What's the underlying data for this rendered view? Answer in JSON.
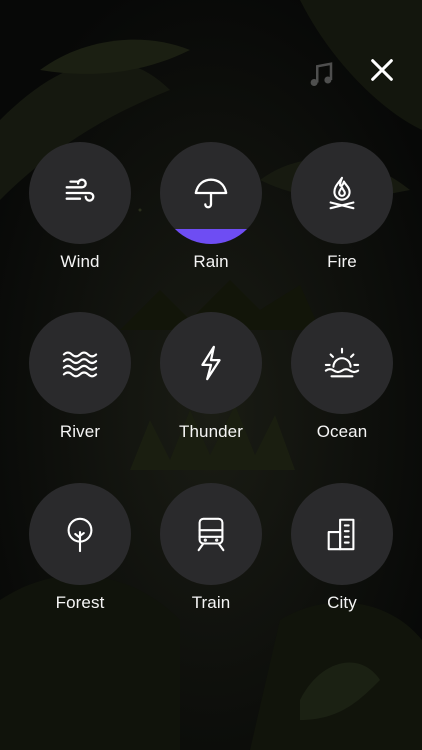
{
  "top_bar": {
    "music_icon": "music-note-icon",
    "close_icon": "close-icon"
  },
  "colors": {
    "background": "#0b0c0a",
    "tile": "#2b2b2d",
    "accent": "#6e4df3",
    "text": "#f5f5f5"
  },
  "sounds": [
    {
      "label": "Wind",
      "icon": "wind-icon",
      "level": 0
    },
    {
      "label": "Rain",
      "icon": "umbrella-icon",
      "level": 0.15
    },
    {
      "label": "Fire",
      "icon": "campfire-icon",
      "level": 0
    },
    {
      "label": "River",
      "icon": "waves-icon",
      "level": 0
    },
    {
      "label": "Thunder",
      "icon": "lightning-icon",
      "level": 0
    },
    {
      "label": "Ocean",
      "icon": "sunset-icon",
      "level": 0
    },
    {
      "label": "Forest",
      "icon": "tree-icon",
      "level": 0
    },
    {
      "label": "Train",
      "icon": "train-icon",
      "level": 0
    },
    {
      "label": "City",
      "icon": "buildings-icon",
      "level": 0
    }
  ]
}
